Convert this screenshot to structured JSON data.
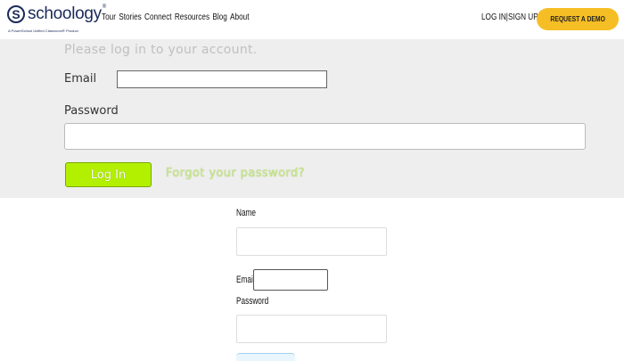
{
  "header": {
    "logo": {
      "letter": "S",
      "word": "schoology",
      "trademark": "®",
      "tagline": "A PowerSchool Unified Classroom® Product"
    },
    "nav": [
      "Tour",
      "Stories",
      "Connect",
      "Resources",
      "Blog",
      "About"
    ],
    "log_in": "LOG IN",
    "separator": "|",
    "sign_up": "SIGN UP",
    "demo_button": "REQUEST A DEMO",
    "colors": {
      "brand": "#1a2a5a",
      "demo": "#f6be25"
    }
  },
  "login_panel": {
    "title": "Please log in to your account.",
    "email_label": "Email",
    "email_value": "",
    "password_label": "Password",
    "password_value": "",
    "login_button": "Log In",
    "forgot_link": "Forgot your password?",
    "colors": {
      "panel_bg": "#eeeeee",
      "login_button": "#b3f000"
    }
  },
  "signup_form": {
    "name_label": "Name",
    "name_value": "",
    "email_label": "Email",
    "email_value": "",
    "password_label": "Password",
    "password_value": ""
  }
}
